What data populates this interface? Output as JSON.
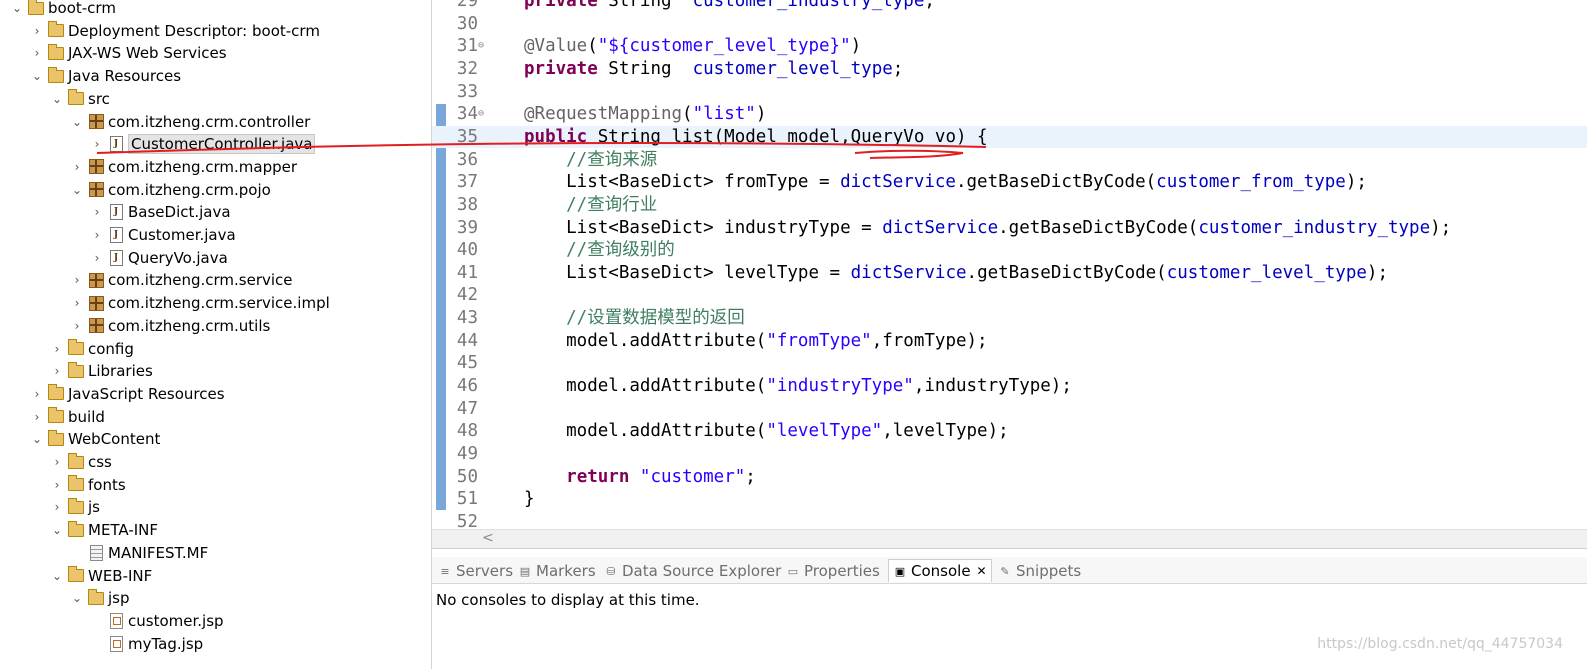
{
  "explorer": {
    "items": [
      {
        "label": "boot-crm",
        "twisty": "v",
        "icon": "project-icon"
      },
      {
        "label": "Deployment Descriptor: boot-crm",
        "twisty": ">",
        "icon": "deployment-descriptor-icon"
      },
      {
        "label": "JAX-WS Web Services",
        "twisty": ">",
        "icon": "web-services-icon"
      },
      {
        "label": "Java Resources",
        "twisty": "v",
        "icon": "java-resources-icon"
      },
      {
        "label": "src",
        "twisty": "v",
        "icon": "source-folder-icon"
      },
      {
        "label": "com.itzheng.crm.controller",
        "twisty": "v",
        "icon": "package-icon"
      },
      {
        "label": "CustomerController.java",
        "twisty": ">",
        "icon": "java-file-icon",
        "selected": true
      },
      {
        "label": "com.itzheng.crm.mapper",
        "twisty": ">",
        "icon": "package-icon"
      },
      {
        "label": "com.itzheng.crm.pojo",
        "twisty": "v",
        "icon": "package-icon"
      },
      {
        "label": "BaseDict.java",
        "twisty": ">",
        "icon": "java-file-icon"
      },
      {
        "label": "Customer.java",
        "twisty": ">",
        "icon": "java-file-icon"
      },
      {
        "label": "QueryVo.java",
        "twisty": ">",
        "icon": "java-file-icon"
      },
      {
        "label": "com.itzheng.crm.service",
        "twisty": ">",
        "icon": "package-icon"
      },
      {
        "label": "com.itzheng.crm.service.impl",
        "twisty": ">",
        "icon": "package-icon"
      },
      {
        "label": "com.itzheng.crm.utils",
        "twisty": ">",
        "icon": "package-icon"
      },
      {
        "label": "config",
        "twisty": ">",
        "icon": "source-folder-icon"
      },
      {
        "label": "Libraries",
        "twisty": ">",
        "icon": "libraries-icon"
      },
      {
        "label": "JavaScript Resources",
        "twisty": ">",
        "icon": "javascript-resources-icon"
      },
      {
        "label": "build",
        "twisty": ">",
        "icon": "folder-icon"
      },
      {
        "label": "WebContent",
        "twisty": "v",
        "icon": "folder-icon"
      },
      {
        "label": "css",
        "twisty": ">",
        "icon": "folder-icon"
      },
      {
        "label": "fonts",
        "twisty": ">",
        "icon": "folder-icon"
      },
      {
        "label": "js",
        "twisty": ">",
        "icon": "folder-icon"
      },
      {
        "label": "META-INF",
        "twisty": "v",
        "icon": "folder-icon"
      },
      {
        "label": "MANIFEST.MF",
        "twisty": "",
        "icon": "manifest-file-icon"
      },
      {
        "label": "WEB-INF",
        "twisty": "v",
        "icon": "folder-icon"
      },
      {
        "label": "jsp",
        "twisty": "v",
        "icon": "folder-icon"
      },
      {
        "label": "customer.jsp",
        "twisty": "",
        "icon": "jsp-file-icon"
      },
      {
        "label": "myTag.jsp",
        "twisty": "",
        "icon": "jsp-file-icon"
      }
    ]
  },
  "editor": {
    "lines": [
      {
        "num": "29",
        "fold": "",
        "code": "private String  customer_industry_type;"
      },
      {
        "num": "30",
        "fold": "",
        "code": ""
      },
      {
        "num": "31",
        "fold": "⊖",
        "code": "@Value(\"${customer_level_type}\")"
      },
      {
        "num": "32",
        "fold": "",
        "code": "private String  customer_level_type;"
      },
      {
        "num": "33",
        "fold": "",
        "code": ""
      },
      {
        "num": "34",
        "fold": "⊖",
        "code": "@RequestMapping(\"list\")"
      },
      {
        "num": "35",
        "fold": "",
        "code": "public String list(Model model,QueryVo vo) {"
      },
      {
        "num": "36",
        "fold": "",
        "code": "    //查询来源"
      },
      {
        "num": "37",
        "fold": "",
        "code": "    List<BaseDict> fromType = dictService.getBaseDictByCode(customer_from_type);"
      },
      {
        "num": "38",
        "fold": "",
        "code": "    //查询行业"
      },
      {
        "num": "39",
        "fold": "",
        "code": "    List<BaseDict> industryType = dictService.getBaseDictByCode(customer_industry_type);"
      },
      {
        "num": "40",
        "fold": "",
        "code": "    //查询级别的"
      },
      {
        "num": "41",
        "fold": "",
        "code": "    List<BaseDict> levelType = dictService.getBaseDictByCode(customer_level_type);"
      },
      {
        "num": "42",
        "fold": "",
        "code": ""
      },
      {
        "num": "43",
        "fold": "",
        "code": "    //设置数据模型的返回"
      },
      {
        "num": "44",
        "fold": "",
        "code": "    model.addAttribute(\"fromType\",fromType);"
      },
      {
        "num": "45",
        "fold": "",
        "code": ""
      },
      {
        "num": "46",
        "fold": "",
        "code": "    model.addAttribute(\"industryType\",industryType);"
      },
      {
        "num": "47",
        "fold": "",
        "code": ""
      },
      {
        "num": "48",
        "fold": "",
        "code": "    model.addAttribute(\"levelType\",levelType);"
      },
      {
        "num": "49",
        "fold": "",
        "code": ""
      },
      {
        "num": "50",
        "fold": "",
        "code": "    return \"customer\";"
      },
      {
        "num": "51",
        "fold": "",
        "code": "}"
      },
      {
        "num": "52",
        "fold": "",
        "code": ""
      }
    ],
    "current_line": "35",
    "scroll_left_arrow": "<"
  },
  "views": {
    "tabs": [
      {
        "label": "Servers",
        "icon": "servers-icon"
      },
      {
        "label": "Markers",
        "icon": "markers-icon"
      },
      {
        "label": "Data Source Explorer",
        "icon": "data-source-icon"
      },
      {
        "label": "Properties",
        "icon": "properties-icon"
      },
      {
        "label": "Console",
        "icon": "console-icon",
        "active": true,
        "close": "✕"
      },
      {
        "label": "Snippets",
        "icon": "snippets-icon"
      }
    ],
    "console_message": "No consoles to display at this time."
  },
  "watermark": "https://blog.csdn.net/qq_44757034",
  "colors": {
    "keyword": "#7f0055",
    "field": "#0000c0",
    "string": "#2a00ff",
    "comment": "#3f7f5f",
    "annotation_stroke": "#e02020"
  }
}
